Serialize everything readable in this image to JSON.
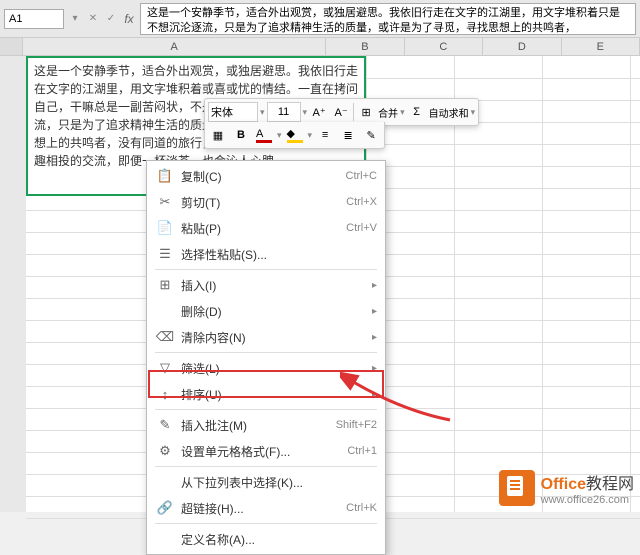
{
  "formula_bar": {
    "name_box": "A1",
    "content": "这是一个安静季节，适合外出观赏，或独居避思。我依旧行走在文字的江湖里，用文字堆积着只是不想沉沦逐流，只是为了追求精神生活的质量，或许是为了寻觅，寻找思想上的共鸣者，"
  },
  "columns": [
    "A",
    "B",
    "C",
    "D",
    "E"
  ],
  "cell_content": "这是一个安静季节，适合外出观赏，或独居避思。我依旧行走在文字的江湖里，用文字堆积着或喜或忧的情结。一直在拷问自己，干嘛总是一副苦闷状，不是因为彷徨，只是不想沉沦逐流，只是为了追求精神生活的质量，或许是为了寻觅，寻找思想上的共鸣者，没有同道的旅行，再美的风景也形如虚设，志趣相投的交流，即便一杯淡茶，也会沁人心脾。",
  "mini_toolbar": {
    "font": "宋体",
    "size": "11",
    "merge": "合并",
    "autosum": "自动求和"
  },
  "context_menu": {
    "items": [
      {
        "icon": "📋",
        "label": "复制(C)",
        "shortcut": "Ctrl+C"
      },
      {
        "icon": "✂",
        "label": "剪切(T)",
        "shortcut": "Ctrl+X"
      },
      {
        "icon": "📄",
        "label": "粘贴(P)",
        "shortcut": "Ctrl+V"
      },
      {
        "icon": "☰",
        "label": "选择性粘贴(S)...",
        "shortcut": ""
      },
      {
        "icon": "⊞",
        "label": "插入(I)",
        "shortcut": "",
        "submenu": true
      },
      {
        "icon": "",
        "label": "删除(D)",
        "shortcut": "",
        "submenu": true
      },
      {
        "icon": "⌫",
        "label": "清除内容(N)",
        "shortcut": "",
        "submenu": true
      },
      {
        "icon": "▽",
        "label": "筛选(L)",
        "shortcut": "",
        "submenu": true
      },
      {
        "icon": "↕",
        "label": "排序(U)",
        "shortcut": "",
        "submenu": true
      },
      {
        "icon": "✎",
        "label": "插入批注(M)",
        "shortcut": "Shift+F2"
      },
      {
        "icon": "⚙",
        "label": "设置单元格格式(F)...",
        "shortcut": "Ctrl+1"
      },
      {
        "icon": "",
        "label": "从下拉列表中选择(K)...",
        "shortcut": ""
      },
      {
        "icon": "🔗",
        "label": "超链接(H)...",
        "shortcut": "Ctrl+K"
      },
      {
        "icon": "",
        "label": "定义名称(A)...",
        "shortcut": ""
      }
    ]
  },
  "watermark": {
    "brand_prefix": "Office",
    "brand_suffix": "教程网",
    "url": "www.office26.com"
  }
}
